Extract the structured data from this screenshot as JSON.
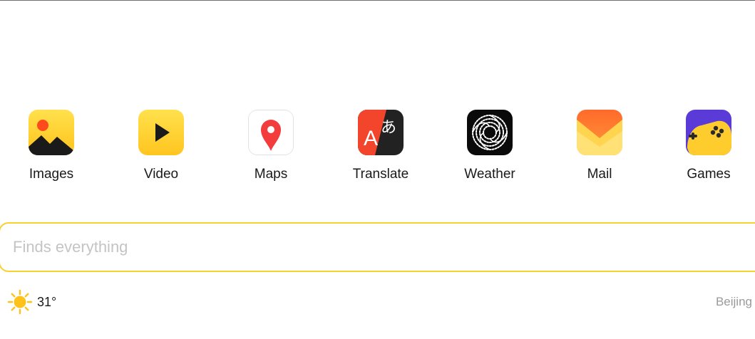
{
  "services": [
    {
      "label": "Images",
      "icon": "images-icon"
    },
    {
      "label": "Video",
      "icon": "video-icon"
    },
    {
      "label": "Maps",
      "icon": "maps-icon"
    },
    {
      "label": "Translate",
      "icon": "translate-icon"
    },
    {
      "label": "Weather",
      "icon": "weather-icon"
    },
    {
      "label": "Mail",
      "icon": "mail-icon"
    },
    {
      "label": "Games",
      "icon": "games-icon"
    }
  ],
  "search": {
    "placeholder": "Finds everything",
    "value": ""
  },
  "weather": {
    "temperature": "31°",
    "icon": "sun-icon"
  },
  "location": {
    "city": "Beijing"
  },
  "colors": {
    "accent": "#f7d12e",
    "placeholder": "#c4c4c4",
    "muted": "#9a9a9a"
  }
}
